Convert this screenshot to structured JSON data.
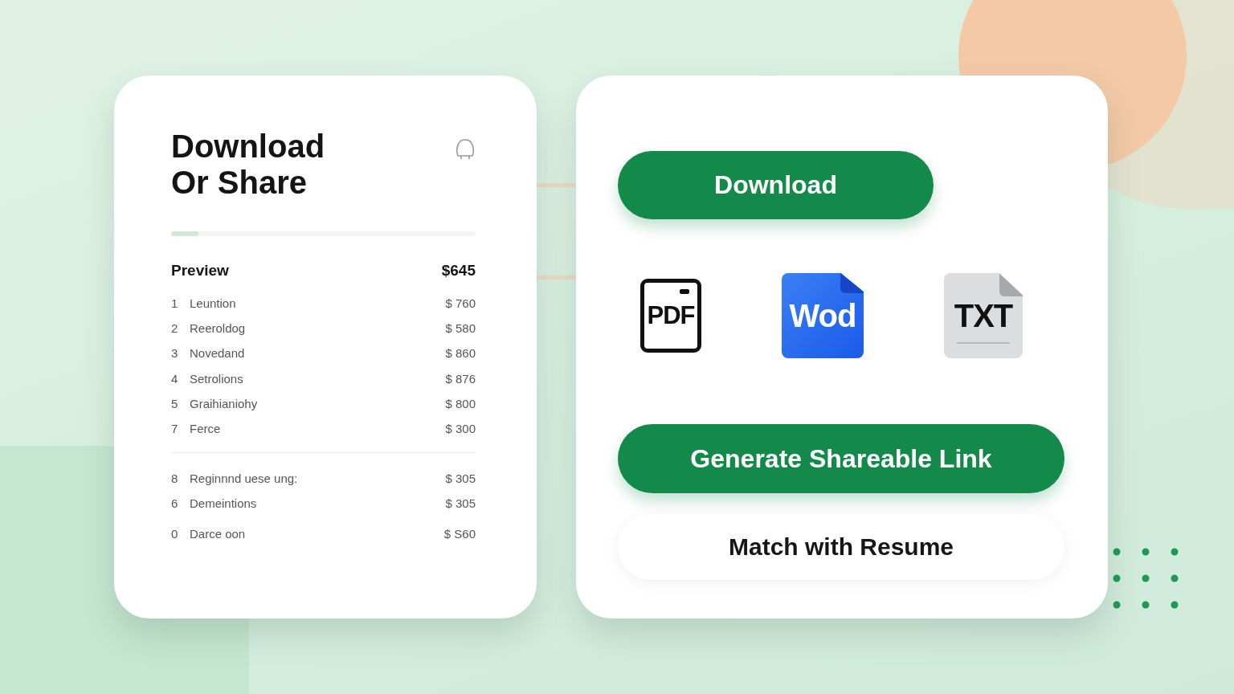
{
  "panel": {
    "title": "Download Or Share",
    "progress": {
      "level": 0.09
    },
    "preview": {
      "title": "Preview",
      "total": "$645",
      "groups": [
        [
          {
            "number": "1",
            "name": "Leuntion",
            "amount": "$ 760"
          },
          {
            "number": "2",
            "name": "Reeroldog",
            "amount": "$ 580"
          },
          {
            "number": "3",
            "name": "Novedand",
            "amount": "$ 860"
          },
          {
            "number": "4",
            "name": "Setrolions",
            "amount": "$ 876"
          },
          {
            "number": "5",
            "name": "Graihianiohy",
            "amount": "$ 800"
          },
          {
            "number": "7",
            "name": "Ferce",
            "amount": "$ 300"
          }
        ],
        [
          {
            "number": "8",
            "name": "Reginnnd uese ung:",
            "amount": "$ 305"
          },
          {
            "number": "6",
            "name": "Demeintions",
            "amount": "$ 305"
          },
          {
            "number": "0",
            "name": "Darce oon",
            "amount": "$ S60"
          }
        ]
      ]
    }
  },
  "actions": {
    "download": "Download",
    "formats": [
      {
        "kind": "pdf",
        "label": "PDF"
      },
      {
        "kind": "word",
        "label": "Wod"
      },
      {
        "kind": "txt",
        "label": "TXT"
      }
    ],
    "share": "Generate Shareable Link",
    "match": "Match with Resume"
  }
}
